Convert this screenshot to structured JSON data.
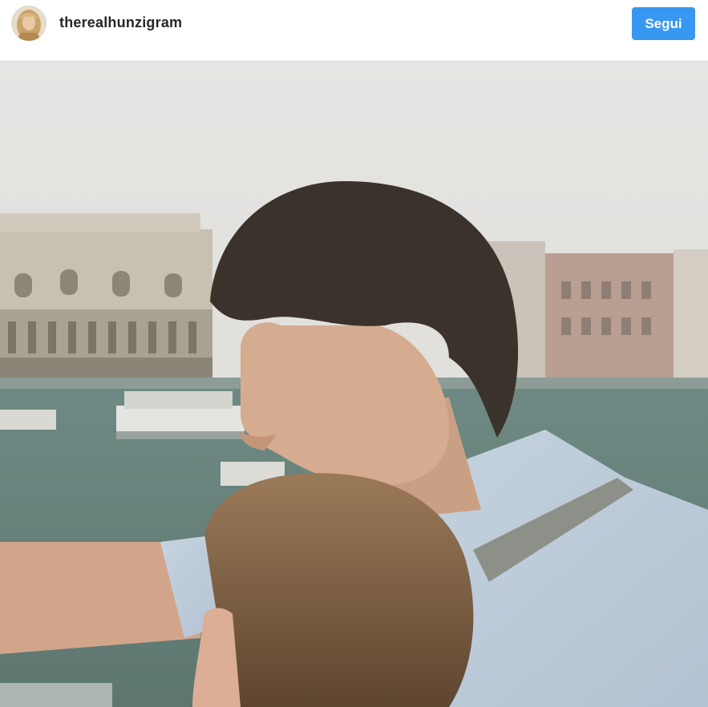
{
  "header": {
    "username": "therealhunzigram",
    "avatar_icon": "profile-avatar",
    "follow_label": "Segui"
  },
  "colors": {
    "accent": "#3897f0",
    "username": "#262626",
    "divider": "#efefef"
  },
  "photo": {
    "subject": "vintage-photo"
  }
}
